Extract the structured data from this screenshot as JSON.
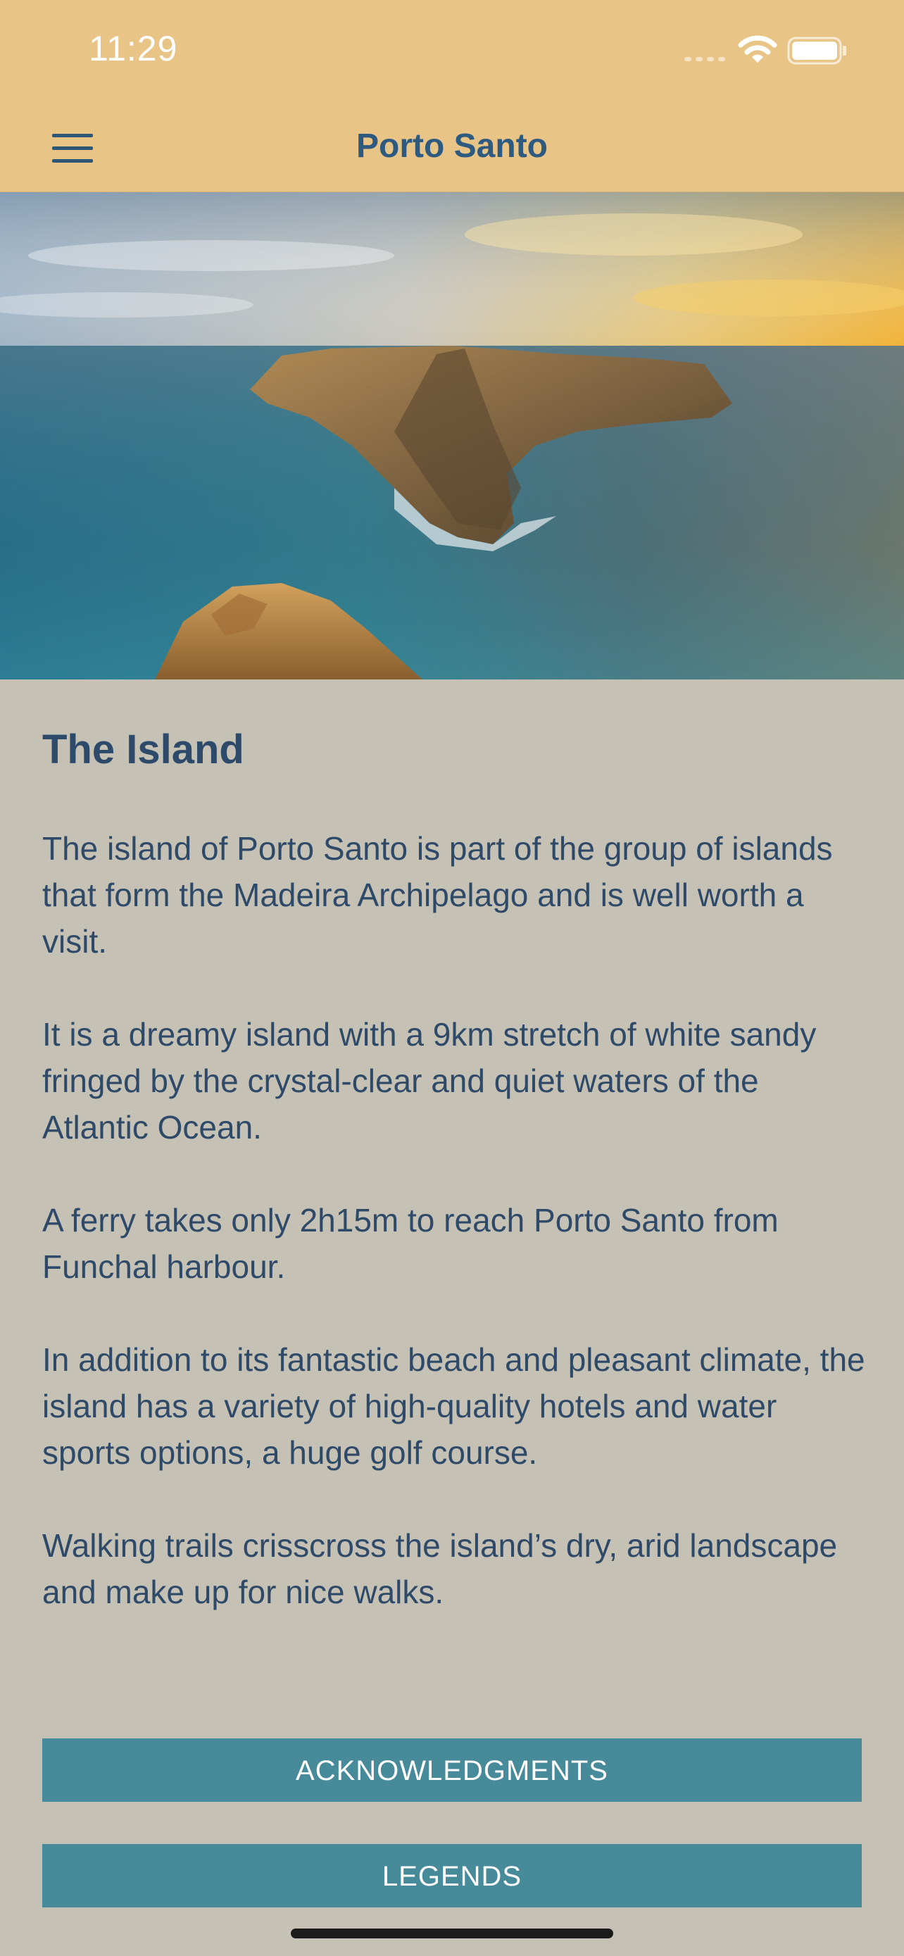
{
  "status_bar": {
    "time": "11:29",
    "icons": [
      "signal-icon",
      "wifi-icon",
      "battery-icon"
    ]
  },
  "nav_bar": {
    "title": "Porto Santo",
    "menu_icon": "hamburger-menu-icon"
  },
  "colors": {
    "header_background": "#e9c487",
    "page_background": "#c5c1b5",
    "button_background": "#478a99",
    "title_text": "#2f5a80",
    "body_text": "#2f4a68"
  },
  "hero_image": {
    "description_icon": "island-photo"
  },
  "article": {
    "heading": "The Island",
    "paragraphs": [
      "The island of Porto Santo is part of the group of islands that form the Madeira Archipelago and is well worth a visit.",
      "It is a dreamy island with a 9km stretch of white sandy fringed by the crystal-clear and quiet waters of the Atlantic Ocean.",
      "A ferry takes only 2h15m to reach Porto Santo from Funchal harbour.",
      "In addition to its fantastic beach and pleasant climate, the island has a variety of high-quality hotels and water sports options, a huge golf course.",
      "Walking trails crisscross the island’s dry, arid landscape and make up for nice walks."
    ]
  },
  "buttons": {
    "acknowledgments": "ACKNOWLEDGMENTS",
    "legends": "LEGENDS"
  }
}
